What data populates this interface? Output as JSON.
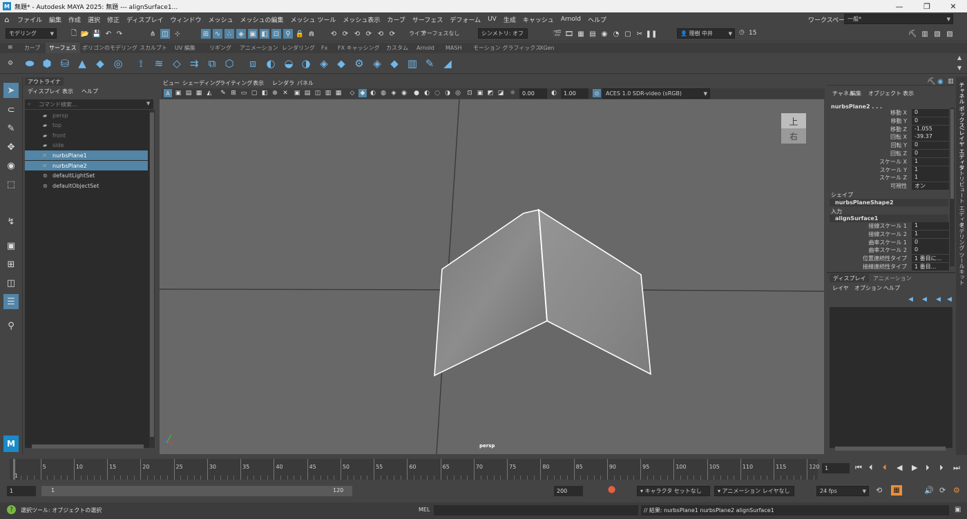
{
  "window": {
    "title": "無題* - Autodesk MAYA 2025: 無題   ---   alignSurface1...",
    "logo": "M",
    "minimize_icon": "minimize-icon",
    "maximize_icon": "maximize-icon",
    "close_icon": "close-icon"
  },
  "menubar": {
    "items": [
      "ファイル",
      "編集",
      "作成",
      "選択",
      "修正",
      "ディスプレイ",
      "ウィンドウ",
      "メッシュ",
      "メッシュの編集",
      "メッシュ ツール",
      "メッシュ表示",
      "カーブ",
      "サーフェス",
      "デフォーム",
      "UV",
      "生成",
      "キャッシュ",
      "Arnold",
      "ヘルプ"
    ],
    "workspace_label": "ワークスペース :",
    "workspace_value": "一般*"
  },
  "statusline": {
    "mode": "モデリング",
    "live_label": "ライブ",
    "live_value": "サーフェスなし",
    "symmetry": "シンメトリ: オフ",
    "user": "理樹 中井",
    "credits": "15"
  },
  "shelf": {
    "tabs": [
      "カーブ",
      "サーフェス",
      "ポリゴンのモデリング",
      "スカルプト",
      "UV 編集",
      "リギング",
      "アニメーション",
      "レンダリング",
      "Fx",
      "FX キャッシング",
      "カスタム",
      "Arnold",
      "MASH",
      "モーション グラフィックス",
      "XGen"
    ],
    "active_tab": "サーフェス"
  },
  "outliner": {
    "tab": "アウトライナ",
    "menu": [
      "ディスプレイ",
      "表示",
      "ヘルプ"
    ],
    "search_placeholder": "コマンド検索...",
    "items": [
      {
        "label": "persp",
        "icon": "camera-icon",
        "state": "dim"
      },
      {
        "label": "top",
        "icon": "camera-icon",
        "state": "dim"
      },
      {
        "label": "front",
        "icon": "camera-icon",
        "state": "dim"
      },
      {
        "label": "side",
        "icon": "camera-icon",
        "state": "dim"
      },
      {
        "label": "nurbsPlane1",
        "icon": "nurbs-surface-icon",
        "state": "selected"
      },
      {
        "label": "nurbsPlane2",
        "icon": "nurbs-surface-icon",
        "state": "selected"
      },
      {
        "label": "defaultLightSet",
        "icon": "set-icon",
        "state": "normal"
      },
      {
        "label": "defaultObjectSet",
        "icon": "set-icon",
        "state": "normal"
      }
    ]
  },
  "viewport": {
    "menu": [
      "ビュー",
      "シェーディング",
      "ライティング",
      "表示",
      "レンダラ",
      "パネル"
    ],
    "exposure": "0.00",
    "gamma": "1.00",
    "colorspace": "ACES 1.0 SDR-video (sRGB)",
    "camera_label": "persp",
    "viewcube_top": "上",
    "viewcube_right": "右"
  },
  "channelbox": {
    "menu": [
      "チャネル",
      "編集",
      "オブジェクト",
      "表示"
    ],
    "object": "nurbsPlane2 . . .",
    "attributes": [
      {
        "label": "移動 X",
        "value": "0"
      },
      {
        "label": "移動 Y",
        "value": "0"
      },
      {
        "label": "移動 Z",
        "value": "-1.055"
      },
      {
        "label": "回転 X",
        "value": "-39.37"
      },
      {
        "label": "回転 Y",
        "value": "0"
      },
      {
        "label": "回転 Z",
        "value": "0"
      },
      {
        "label": "スケール X",
        "value": "1"
      },
      {
        "label": "スケール Y",
        "value": "1"
      },
      {
        "label": "スケール Z",
        "value": "1"
      },
      {
        "label": "可視性",
        "value": "オン"
      }
    ],
    "shape_header": "シェイプ",
    "shape_name": "nurbsPlaneShape2",
    "input_header": "入力",
    "input_name": "alignSurface1",
    "input_attributes": [
      {
        "label": "接線スケール 1",
        "value": "1"
      },
      {
        "label": "接線スケール 2",
        "value": "1"
      },
      {
        "label": "曲率スケール 1",
        "value": "0"
      },
      {
        "label": "曲率スケール 2",
        "value": "0"
      },
      {
        "label": "位置連続性タイプ",
        "value": "1 番目に..."
      },
      {
        "label": "接線連続性タイプ",
        "value": "1 番目..."
      }
    ],
    "layer_tabs": [
      "ディスプレイ",
      "アニメーション"
    ],
    "layer_menu": [
      "レイヤ",
      "オプション",
      "ヘルプ"
    ],
    "side_tabs": [
      "チャネル ボックス/レイヤ エディタ",
      "アトリビュート エディタ",
      "モデリング ツールキット"
    ]
  },
  "timeline": {
    "ticks": [
      5,
      10,
      15,
      20,
      25,
      30,
      35,
      40,
      45,
      50,
      55,
      60,
      65,
      70,
      75,
      80,
      85,
      90,
      95,
      100,
      105,
      110,
      115,
      120
    ],
    "start_label": "1",
    "current_frame": "1",
    "range_start": "1",
    "range_inner_start": "1",
    "range_inner_end": "120",
    "range_end": "200",
    "character_set": "キャラクタ セットなし",
    "anim_layer": "アニメーション レイヤなし",
    "fps": "24 fps"
  },
  "status": {
    "help": "選択ツール: オブジェクトの選択",
    "mel_label": "MEL",
    "result": "// 結果: nurbsPlane1 nurbsPlane2 alignSurface1"
  }
}
